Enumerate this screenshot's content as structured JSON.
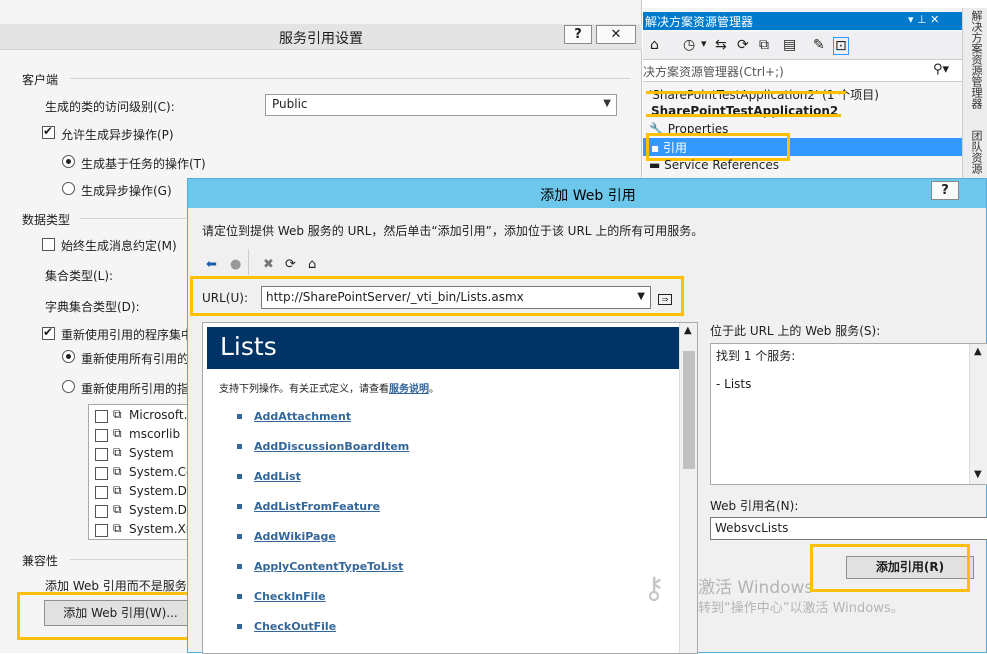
{
  "service_reference_settings": {
    "title": "服务引用设置",
    "help_label": "?",
    "close_label": "✕",
    "client_section": "客户端",
    "access_level_label": "生成的类的访问级别(C):",
    "access_level_value": "Public",
    "async_ops_label": "允许生成异步操作(P)",
    "task_based_label": "生成基于任务的操作(T)",
    "async_label": "生成异步操作(G)",
    "data_type_section": "数据类型",
    "always_gen_label": "始终生成消息约定(M)",
    "collection_type_label": "集合类型(L):",
    "dict_collection_type_label": "字典集合类型(D):",
    "reuse_types_label": "重新使用引用的程序集中",
    "reuse_all_label": "重新使用所有引用的",
    "reuse_specified_label": "重新使用所引用的指",
    "assemblies": [
      "Microsoft.",
      "mscorlib",
      "System",
      "System.Co",
      "System.Da",
      "System.Da",
      "System.Xn"
    ],
    "compat_section": "兼容性",
    "compat_desc": "添加 Web 引用而不是服务",
    "add_web_ref_button": "添加 Web 引用(W)..."
  },
  "solution_explorer": {
    "title": "解决方案资源管理器",
    "pin_label": "▾ ⊥ ✕",
    "search_placeholder": "决方案资源管理器(Ctrl+;)",
    "items": [
      {
        "label": "'SharePointTestApplication2' (1 个项目)"
      },
      {
        "label": "SharePointTestApplication2"
      },
      {
        "label": "Properties"
      },
      {
        "label": "引用"
      },
      {
        "label": "Service References"
      }
    ],
    "side_tabs": [
      "解决方案资源管理器",
      "团队资源"
    ]
  },
  "add_web_reference": {
    "title": "添加 Web 引用",
    "help_label": "?",
    "instruction": "请定位到提供 Web 服务的 URL，然后单击“添加引用”，添加位于该 URL 上的所有可用服务。",
    "url_label": "URL(U):",
    "url_value": "http://SharePointServer/_vti_bin/Lists.asmx",
    "go_label": "⇒",
    "browser": {
      "heading": "Lists",
      "desc_prefix": "支持下列操作。有关正式定义，请查看",
      "desc_link": "服务说明",
      "desc_suffix": "。",
      "operations": [
        "AddAttachment",
        "AddDiscussionBoardItem",
        "AddList",
        "AddListFromFeature",
        "AddWikiPage",
        "ApplyContentTypeToList",
        "CheckInFile",
        "CheckOutFile"
      ]
    },
    "services_label": "位于此 URL 上的 Web 服务(S):",
    "services_found": "找到 1 个服务:",
    "services_item": "- Lists",
    "ref_name_label": "Web 引用名(N):",
    "ref_name_value": "WebsvcLists",
    "add_ref_button": "添加引用(R)"
  },
  "watermark": {
    "line1": "激活 Windows",
    "line2": "转到“操作中心”以激活 Windows。"
  },
  "colors": {
    "highlight": "#ffc000",
    "se_title_bg": "#007acc",
    "selected_bg": "#3399ff",
    "dialog_title_bg": "#6cc7ea",
    "browser_banner": "#003366",
    "link": "#336699"
  }
}
